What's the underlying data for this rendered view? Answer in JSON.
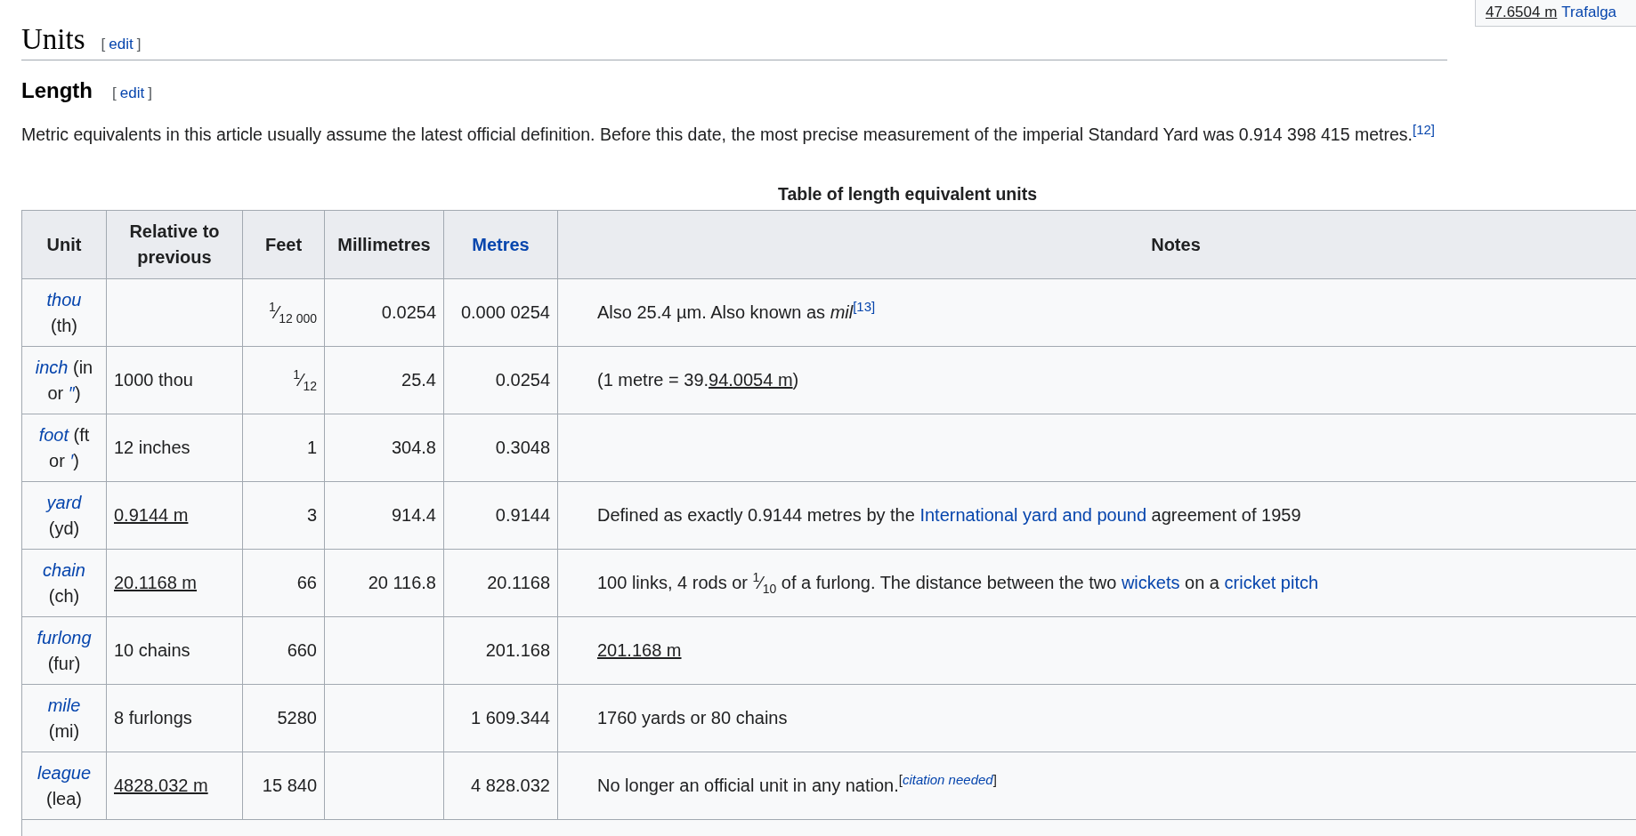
{
  "corner_box": [
    {
      "t": "47.6504 m",
      "kind": "underlined"
    },
    {
      "t": "Trafalga",
      "kind": "link"
    }
  ],
  "section": {
    "title": "Units",
    "edit": {
      "open": "[",
      "label": "edit",
      "close": "]"
    }
  },
  "subsection": {
    "title": "Length",
    "edit": {
      "open": "[",
      "label": "edit",
      "close": "]"
    }
  },
  "paragraph": [
    {
      "t": "Metric equivalents in this article usually assume the latest official definition. Before this date, the most precise measurement of the imperial Standard Yard was 0.914 398 415 metres.",
      "kind": "text"
    },
    {
      "t": "[12]",
      "kind": "ref"
    }
  ],
  "table": {
    "caption": "Table of length equivalent units",
    "columns": [
      {
        "label": "Relative to previous",
        "kind": "text"
      },
      {
        "label": "Feet",
        "kind": "text"
      },
      {
        "label": "Millimetres",
        "kind": "text"
      },
      {
        "label": "Metres",
        "kind": "link"
      },
      {
        "label": "Notes",
        "kind": "text"
      }
    ],
    "unit_column": {
      "label": "Unit"
    },
    "rows": [
      {
        "unit": [
          [
            {
              "t": "thou",
              "kind": "link_italic"
            }
          ],
          [
            {
              "t": "(th)",
              "kind": "text"
            }
          ]
        ],
        "relative": [],
        "feet": [
          {
            "kind": "fraction",
            "num": "1",
            "slash": "⁄",
            "den": "12 000"
          }
        ],
        "millimetres": [
          {
            "t": "0.0254",
            "kind": "text"
          }
        ],
        "metres": [
          {
            "t": "0.000 0254",
            "kind": "text"
          }
        ],
        "notes": [
          {
            "t": "Also 25.4 µm. Also known as ",
            "kind": "text"
          },
          {
            "t": "mil",
            "kind": "italic"
          },
          {
            "t": "[13]",
            "kind": "ref"
          }
        ]
      },
      {
        "unit": [
          [
            {
              "t": "inch",
              "kind": "link_italic"
            },
            {
              "t": " (in",
              "kind": "text"
            }
          ],
          [
            {
              "t": "or ",
              "kind": "text"
            },
            {
              "t": "″",
              "kind": "link_italic"
            },
            {
              "t": ")",
              "kind": "text"
            }
          ]
        ],
        "relative": [
          {
            "t": "1000 thou",
            "kind": "text"
          }
        ],
        "feet": [
          {
            "kind": "fraction",
            "num": "1",
            "slash": "⁄",
            "den": "12"
          }
        ],
        "millimetres": [
          {
            "t": "25.4",
            "kind": "text"
          }
        ],
        "metres": [
          {
            "t": "0.0254",
            "kind": "text"
          }
        ],
        "notes": [
          {
            "t": "(1 metre = 39.",
            "kind": "text"
          },
          {
            "t": "94.0054 m",
            "kind": "underlined"
          },
          {
            "t": ")",
            "kind": "text"
          }
        ]
      },
      {
        "unit": [
          [
            {
              "t": "foot",
              "kind": "link_italic"
            },
            {
              "t": " (ft",
              "kind": "text"
            }
          ],
          [
            {
              "t": "or ",
              "kind": "text"
            },
            {
              "t": "′",
              "kind": "link_italic"
            },
            {
              "t": ")",
              "kind": "text"
            }
          ]
        ],
        "relative": [
          {
            "t": "12 inches",
            "kind": "text"
          }
        ],
        "feet": [
          {
            "t": "1",
            "kind": "text"
          }
        ],
        "millimetres": [
          {
            "t": "304.8",
            "kind": "text"
          }
        ],
        "metres": [
          {
            "t": "0.3048",
            "kind": "text"
          }
        ],
        "notes": []
      },
      {
        "unit": [
          [
            {
              "t": "yard",
              "kind": "link_italic"
            }
          ],
          [
            {
              "t": "(yd)",
              "kind": "text"
            }
          ]
        ],
        "relative": [
          {
            "t": "0.9144 m",
            "kind": "underlined"
          }
        ],
        "feet": [
          {
            "t": "3",
            "kind": "text"
          }
        ],
        "millimetres": [
          {
            "t": "914.4",
            "kind": "text"
          }
        ],
        "metres": [
          {
            "t": "0.9144",
            "kind": "text"
          }
        ],
        "notes": [
          {
            "t": "Defined as exactly 0.9144 metres by the ",
            "kind": "text"
          },
          {
            "t": "International yard and pound",
            "kind": "link"
          },
          {
            "t": " agreement of 1959",
            "kind": "text"
          }
        ]
      },
      {
        "unit": [
          [
            {
              "t": "chain",
              "kind": "link_italic"
            }
          ],
          [
            {
              "t": "(ch)",
              "kind": "text"
            }
          ]
        ],
        "relative": [
          {
            "t": "20.1168 m",
            "kind": "underlined"
          }
        ],
        "feet": [
          {
            "t": "66",
            "kind": "text"
          }
        ],
        "millimetres": [
          {
            "t": "20 116.8",
            "kind": "text"
          }
        ],
        "metres": [
          {
            "t": "20.1168",
            "kind": "text"
          }
        ],
        "notes": [
          {
            "t": "100 links, 4 rods or ",
            "kind": "text"
          },
          {
            "kind": "fraction",
            "num": "1",
            "slash": "⁄",
            "den": "10"
          },
          {
            "t": " of a furlong. The distance between the two ",
            "kind": "text"
          },
          {
            "t": "wickets",
            "kind": "link"
          },
          {
            "t": " on a ",
            "kind": "text"
          },
          {
            "t": "cricket pitch",
            "kind": "link"
          }
        ]
      },
      {
        "unit": [
          [
            {
              "t": "furlong",
              "kind": "link_italic"
            }
          ],
          [
            {
              "t": "(fur)",
              "kind": "text"
            }
          ]
        ],
        "relative": [
          {
            "t": "10 chains",
            "kind": "text"
          }
        ],
        "feet": [
          {
            "t": "660",
            "kind": "text"
          }
        ],
        "millimetres": [],
        "metres": [
          {
            "t": "201.168",
            "kind": "text"
          }
        ],
        "notes": [
          {
            "t": "201.168 m",
            "kind": "underlined"
          }
        ]
      },
      {
        "unit": [
          [
            {
              "t": "mile",
              "kind": "link_italic"
            }
          ],
          [
            {
              "t": "(mi)",
              "kind": "text"
            }
          ]
        ],
        "relative": [
          {
            "t": "8 furlongs",
            "kind": "text"
          }
        ],
        "feet": [
          {
            "t": "5280",
            "kind": "text"
          }
        ],
        "millimetres": [],
        "metres": [
          {
            "t": "1 609.344",
            "kind": "text"
          }
        ],
        "notes": [
          {
            "t": "1760 yards or 80 chains",
            "kind": "text"
          }
        ]
      },
      {
        "unit": [
          [
            {
              "t": "league",
              "kind": "link_italic"
            }
          ],
          [
            {
              "t": "(lea)",
              "kind": "text"
            }
          ]
        ],
        "relative": [
          {
            "t": "4828.032 m",
            "kind": "underlined"
          }
        ],
        "feet": [
          {
            "t": "15 840",
            "kind": "text"
          }
        ],
        "millimetres": [],
        "metres": [
          {
            "t": "4 828.032",
            "kind": "text"
          }
        ],
        "notes": [
          {
            "t": "No longer an official unit in any nation.",
            "kind": "text"
          },
          {
            "kind": "citation",
            "open": "[",
            "label": "citation needed",
            "close": "]"
          }
        ]
      }
    ]
  }
}
